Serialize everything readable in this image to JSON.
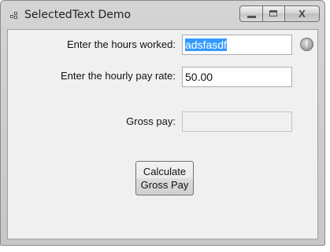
{
  "window": {
    "title": "SelectedText Demo",
    "icon": "app-window-icon",
    "caption_buttons": {
      "minimize": "minimize-icon",
      "maximize": "maximize-icon",
      "close_label": "X"
    }
  },
  "form": {
    "hours_label": "Enter the hours worked:",
    "hours_value": "adsfasdf",
    "hours_error_icon": "!",
    "rate_label": "Enter the hourly pay rate:",
    "rate_value": "50.00",
    "gross_label": "Gross pay:",
    "gross_value": "",
    "calculate_line1": "Calculate",
    "calculate_line2": "Gross Pay"
  },
  "colors": {
    "selection": "#3399ff",
    "client_background": "#f0f0f0"
  }
}
